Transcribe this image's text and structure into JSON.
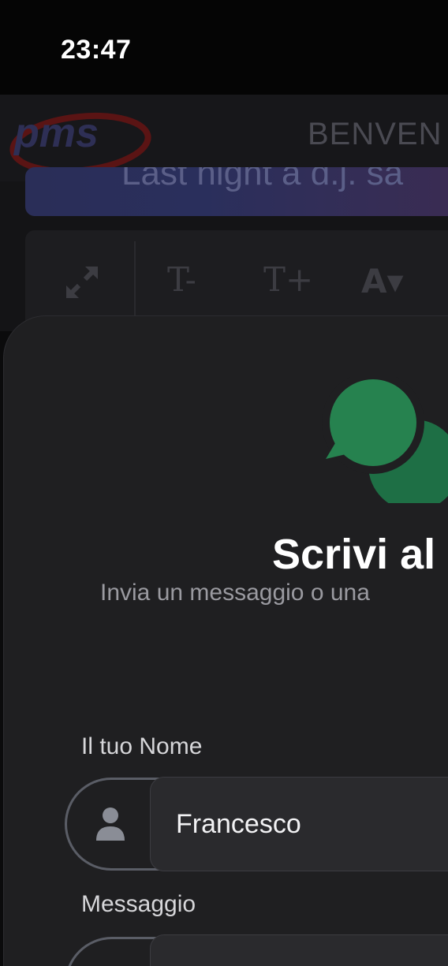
{
  "status_bar": {
    "time": "23:47"
  },
  "background_app": {
    "logo_text": "pms",
    "welcome_text": "BENVEN",
    "ticker_text": "Last night a d.j. sa",
    "toolbar": {
      "text_smaller_label": "T-",
      "text_larger_label": "T+",
      "font_color_label": "A▾"
    }
  },
  "modal": {
    "title": "Scrivi al",
    "subtitle": "Invia un messaggio o una",
    "name_field": {
      "label": "Il tuo Nome",
      "value": "Francesco"
    },
    "message_field": {
      "label": "Messaggio",
      "value": ""
    }
  },
  "colors": {
    "accent_green": "#1e7a4a",
    "sheet_background": "#1f1f21",
    "input_background": "#2a2a2d"
  },
  "icons": {
    "chat": "chat-bubbles-icon",
    "person": "person-icon",
    "expand": "expand-icon"
  }
}
